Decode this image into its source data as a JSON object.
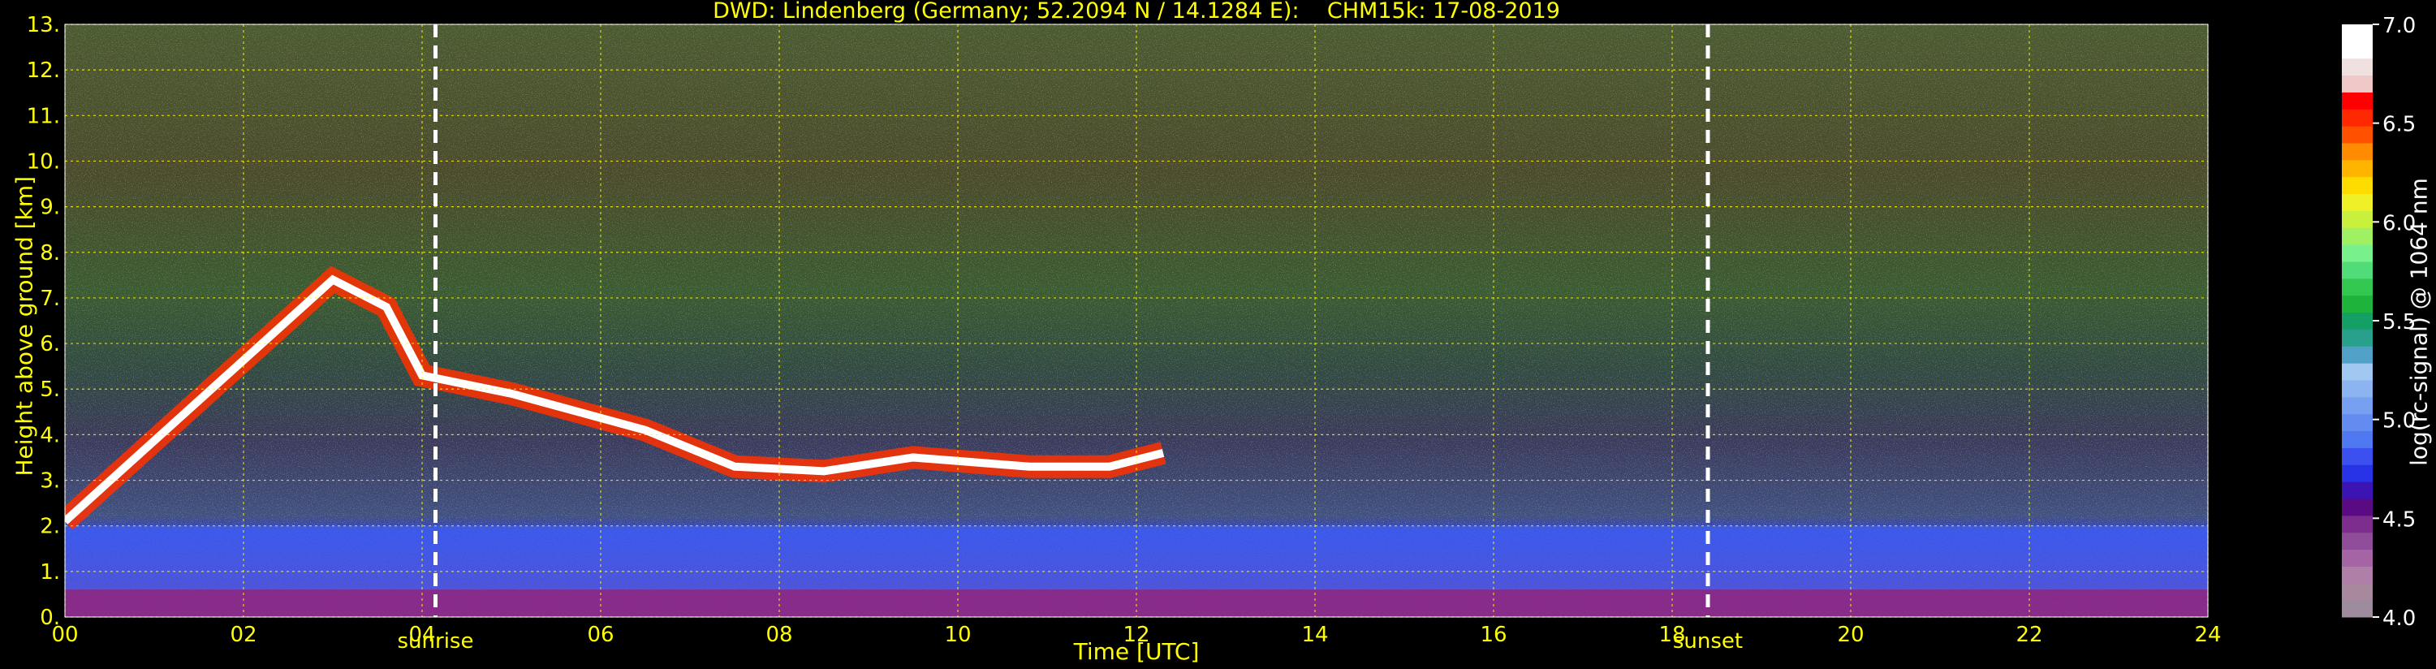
{
  "chart_data": {
    "type": "heatmap",
    "title": "DWD: Lindenberg (Germany; 52.2094 N / 14.1284 E):    CHM15k: 17-08-2019",
    "xlabel": "Time [UTC]",
    "ylabel": "Height above ground [km]",
    "x_ticks": [
      "00",
      "02",
      "04",
      "06",
      "08",
      "10",
      "12",
      "14",
      "16",
      "18",
      "20",
      "22",
      "24"
    ],
    "y_ticks": [
      "0.",
      "1.",
      "2.",
      "3.",
      "4.",
      "5.",
      "6.",
      "7.",
      "8.",
      "9.",
      "10.",
      "11.",
      "12.",
      "13."
    ],
    "xlim": [
      0,
      24
    ],
    "ylim": [
      0,
      13
    ],
    "grid": true,
    "events": [
      {
        "label": "sunrise",
        "time": 4.15
      },
      {
        "label": "sunset",
        "time": 18.4
      }
    ],
    "colorbar": {
      "label": "log(rc-signal) @ 1064 nm",
      "range": [
        4.0,
        7.0
      ],
      "ticks": [
        "4.0",
        "4.5",
        "5.0",
        "5.5",
        "6.0",
        "6.5",
        "7.0"
      ],
      "colors": [
        "#9e8c9e",
        "#a8889c",
        "#b07fa9",
        "#a565a4",
        "#8f4d99",
        "#7c2d8e",
        "#5a0a82",
        "#3c14b4",
        "#2832e6",
        "#3c50f0",
        "#5078f0",
        "#648cf0",
        "#78a0f0",
        "#8cb4f0",
        "#a0c8f0",
        "#50a0c8",
        "#28a08c",
        "#14a064",
        "#1eb43c",
        "#32c850",
        "#50dc78",
        "#78f08c",
        "#a0f064",
        "#c8f03c",
        "#f0f028",
        "#ffdc00",
        "#ffb400",
        "#ff8c00",
        "#ff5000",
        "#ff2800",
        "#ff0000",
        "#f0c8c8",
        "#f0e0e0",
        "#ffffff",
        "#ffffff"
      ]
    },
    "features": {
      "aerosol_layer": {
        "height_top_km": 2.0,
        "description_color": "#4060f0"
      },
      "surface_layer": {
        "height_top_km": 0.6
      },
      "cloud_tops_km": [
        {
          "t": 0.0,
          "h": 2.1
        },
        {
          "t": 3.0,
          "h": 7.4
        },
        {
          "t": 3.6,
          "h": 6.8
        },
        {
          "t": 4.0,
          "h": 5.3
        },
        {
          "t": 5.0,
          "h": 4.9
        },
        {
          "t": 6.5,
          "h": 4.1
        },
        {
          "t": 7.5,
          "h": 3.3
        },
        {
          "t": 8.5,
          "h": 3.2
        },
        {
          "t": 9.5,
          "h": 3.5
        },
        {
          "t": 10.8,
          "h": 3.3
        },
        {
          "t": 11.7,
          "h": 3.3
        },
        {
          "t": 12.3,
          "h": 3.6
        }
      ]
    }
  }
}
